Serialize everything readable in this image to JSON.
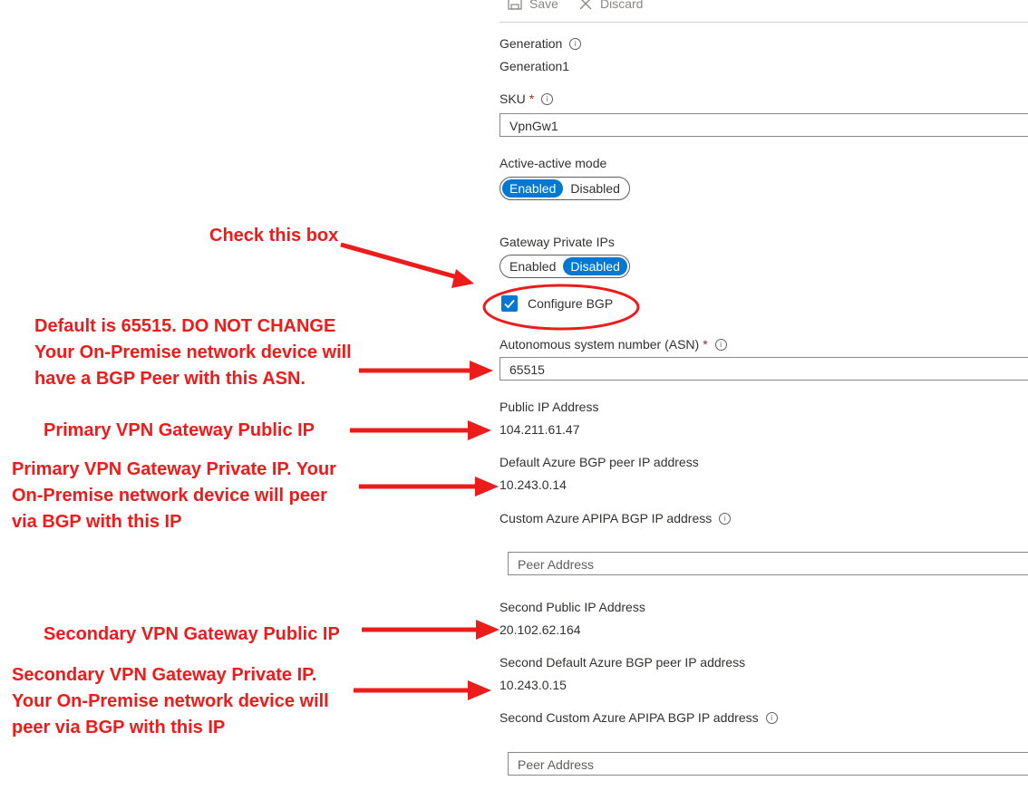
{
  "toolbar": {
    "save_label": "Save",
    "discard_label": "Discard"
  },
  "form": {
    "generation": {
      "label": "Generation",
      "value": "Generation1"
    },
    "sku": {
      "label": "SKU",
      "required": "*",
      "value": "VpnGw1"
    },
    "active_active": {
      "label": "Active-active mode",
      "enabled": "Enabled",
      "disabled": "Disabled",
      "selected": "Enabled"
    },
    "gateway_private_ips": {
      "label": "Gateway Private IPs",
      "enabled": "Enabled",
      "disabled": "Disabled",
      "selected": "Disabled"
    },
    "configure_bgp": {
      "label": "Configure BGP",
      "checked": true
    },
    "asn": {
      "label": "Autonomous system number (ASN)",
      "required": "*",
      "value": "65515"
    },
    "public_ip": {
      "label": "Public IP Address",
      "value": "104.211.61.47"
    },
    "default_bgp_peer": {
      "label": "Default Azure BGP peer IP address",
      "value": "10.243.0.14"
    },
    "custom_apipa": {
      "label": "Custom Azure APIPA BGP IP address",
      "placeholder": "Peer Address"
    },
    "second_public_ip": {
      "label": "Second Public IP Address",
      "value": "20.102.62.164"
    },
    "second_default_bgp_peer": {
      "label": "Second Default Azure BGP peer IP address",
      "value": "10.243.0.15"
    },
    "second_custom_apipa": {
      "label": "Second Custom Azure APIPA BGP IP address",
      "placeholder": "Peer Address"
    }
  },
  "annotations": {
    "check_box": "Check this box",
    "asn_lines": [
      "Default is 65515. DO NOT CHANGE",
      "Your On-Premise network device will",
      "have a BGP Peer with this ASN."
    ],
    "primary_public": "Primary VPN Gateway Public IP",
    "primary_private_lines": [
      "Primary VPN Gateway Private IP. Your",
      "On-Premise network device will peer",
      "via BGP with this IP"
    ],
    "secondary_public": "Secondary VPN Gateway Public IP",
    "secondary_private_lines": [
      "Secondary VPN Gateway Private IP.",
      "Your On-Premise network device will",
      "peer via BGP with this IP"
    ],
    "color": "#ee1b1b"
  },
  "colors": {
    "accent": "#0078d4",
    "required": "#a4262c"
  }
}
